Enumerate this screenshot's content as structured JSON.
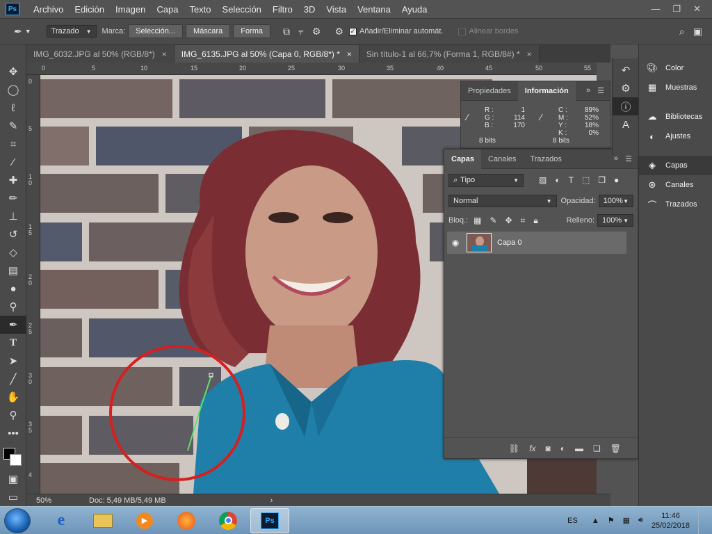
{
  "app": {
    "logo_text": "Ps"
  },
  "menu": [
    "Archivo",
    "Edición",
    "Imagen",
    "Capa",
    "Texto",
    "Selección",
    "Filtro",
    "3D",
    "Vista",
    "Ventana",
    "Ayuda"
  ],
  "options": {
    "mode": "Trazado",
    "marca_label": "Marca:",
    "seleccion_btn": "Selección...",
    "mascara_btn": "Máscara",
    "forma_btn": "Forma",
    "auto_add_label": "Añadir/Eliminar automát.",
    "align_edges": "Alinear bordes"
  },
  "tabs": [
    {
      "label": "IMG_6032.JPG al 50% (RGB/8*)",
      "close": "×"
    },
    {
      "label": "IMG_6135.JPG al 50% (Capa 0, RGB/8*) *",
      "close": "×"
    },
    {
      "label": "Sin título-1 al 66,7% (Forma 1, RGB/8#) *",
      "close": "×"
    }
  ],
  "ruler_top": [
    "0",
    "5",
    "10",
    "15",
    "20",
    "25",
    "30",
    "35",
    "40",
    "45",
    "50",
    "55"
  ],
  "ruler_left": [
    "0",
    "5",
    "1 0",
    "1 5",
    "2 0",
    "2 5",
    "3 0",
    "3 5",
    "4"
  ],
  "status": {
    "zoom": "50%",
    "doc": "Doc: 5,49 MB/5,49 MB"
  },
  "info_panel": {
    "tab_props": "Propiedades",
    "tab_info": "Información",
    "rgb": [
      {
        "k": "R :",
        "v": "1"
      },
      {
        "k": "G :",
        "v": "114"
      },
      {
        "k": "B :",
        "v": "170"
      }
    ],
    "cmyk": [
      {
        "k": "C :",
        "v": "89%"
      },
      {
        "k": "M :",
        "v": "52%"
      },
      {
        "k": "Y :",
        "v": "18%"
      },
      {
        "k": "K :",
        "v": "0%"
      }
    ],
    "bits_left": "8 bits",
    "bits_right": "8 bits"
  },
  "layers_panel": {
    "tabs": [
      "Capas",
      "Canales",
      "Trazados"
    ],
    "filter": "Tipo",
    "blend": "Normal",
    "opacity_label": "Opacidad:",
    "opacity": "100%",
    "lock_label": "Bloq.:",
    "fill_label": "Relleno:",
    "fill": "100%",
    "layer_name": "Capa 0"
  },
  "dock": {
    "items_top": [
      "Color",
      "Muestras"
    ],
    "items_mid": [
      "Bibliotecas",
      "Ajustes"
    ],
    "items_bot": [
      "Capas",
      "Canales",
      "Trazados"
    ]
  },
  "taskbar": {
    "lang": "ES",
    "time": "11:46",
    "date": "25/02/2018"
  },
  "colors": {
    "accent": "#31a8ff",
    "annotation_circle": "#d81e1e",
    "shirt": "#1f7fa8"
  }
}
